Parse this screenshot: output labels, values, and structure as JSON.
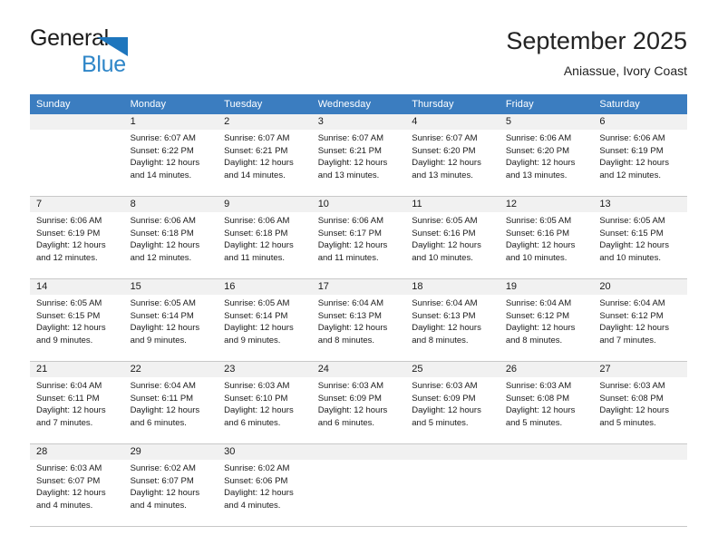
{
  "brand": {
    "line1": "General",
    "line2": "Blue",
    "mark": "triangle-logo-mark"
  },
  "header": {
    "title": "September 2025",
    "subtitle": "Aniassue, Ivory Coast"
  },
  "colors": {
    "header_blue": "#3b7dc0",
    "brand_blue": "#2f86c8",
    "mark_blue": "#1e76bd",
    "daynum_band": "#f1f1f1",
    "grid_line": "#c8c8c8",
    "text": "#1a1a1a"
  },
  "calendar": {
    "weekday_headers": [
      "Sunday",
      "Monday",
      "Tuesday",
      "Wednesday",
      "Thursday",
      "Friday",
      "Saturday"
    ],
    "weeks": [
      [
        {
          "day": "",
          "sunrise": "",
          "sunset": "",
          "daylight_1": "",
          "daylight_2": ""
        },
        {
          "day": "1",
          "sunrise": "Sunrise: 6:07 AM",
          "sunset": "Sunset: 6:22 PM",
          "daylight_1": "Daylight: 12 hours",
          "daylight_2": "and 14 minutes."
        },
        {
          "day": "2",
          "sunrise": "Sunrise: 6:07 AM",
          "sunset": "Sunset: 6:21 PM",
          "daylight_1": "Daylight: 12 hours",
          "daylight_2": "and 14 minutes."
        },
        {
          "day": "3",
          "sunrise": "Sunrise: 6:07 AM",
          "sunset": "Sunset: 6:21 PM",
          "daylight_1": "Daylight: 12 hours",
          "daylight_2": "and 13 minutes."
        },
        {
          "day": "4",
          "sunrise": "Sunrise: 6:07 AM",
          "sunset": "Sunset: 6:20 PM",
          "daylight_1": "Daylight: 12 hours",
          "daylight_2": "and 13 minutes."
        },
        {
          "day": "5",
          "sunrise": "Sunrise: 6:06 AM",
          "sunset": "Sunset: 6:20 PM",
          "daylight_1": "Daylight: 12 hours",
          "daylight_2": "and 13 minutes."
        },
        {
          "day": "6",
          "sunrise": "Sunrise: 6:06 AM",
          "sunset": "Sunset: 6:19 PM",
          "daylight_1": "Daylight: 12 hours",
          "daylight_2": "and 12 minutes."
        }
      ],
      [
        {
          "day": "7",
          "sunrise": "Sunrise: 6:06 AM",
          "sunset": "Sunset: 6:19 PM",
          "daylight_1": "Daylight: 12 hours",
          "daylight_2": "and 12 minutes."
        },
        {
          "day": "8",
          "sunrise": "Sunrise: 6:06 AM",
          "sunset": "Sunset: 6:18 PM",
          "daylight_1": "Daylight: 12 hours",
          "daylight_2": "and 12 minutes."
        },
        {
          "day": "9",
          "sunrise": "Sunrise: 6:06 AM",
          "sunset": "Sunset: 6:18 PM",
          "daylight_1": "Daylight: 12 hours",
          "daylight_2": "and 11 minutes."
        },
        {
          "day": "10",
          "sunrise": "Sunrise: 6:06 AM",
          "sunset": "Sunset: 6:17 PM",
          "daylight_1": "Daylight: 12 hours",
          "daylight_2": "and 11 minutes."
        },
        {
          "day": "11",
          "sunrise": "Sunrise: 6:05 AM",
          "sunset": "Sunset: 6:16 PM",
          "daylight_1": "Daylight: 12 hours",
          "daylight_2": "and 10 minutes."
        },
        {
          "day": "12",
          "sunrise": "Sunrise: 6:05 AM",
          "sunset": "Sunset: 6:16 PM",
          "daylight_1": "Daylight: 12 hours",
          "daylight_2": "and 10 minutes."
        },
        {
          "day": "13",
          "sunrise": "Sunrise: 6:05 AM",
          "sunset": "Sunset: 6:15 PM",
          "daylight_1": "Daylight: 12 hours",
          "daylight_2": "and 10 minutes."
        }
      ],
      [
        {
          "day": "14",
          "sunrise": "Sunrise: 6:05 AM",
          "sunset": "Sunset: 6:15 PM",
          "daylight_1": "Daylight: 12 hours",
          "daylight_2": "and 9 minutes."
        },
        {
          "day": "15",
          "sunrise": "Sunrise: 6:05 AM",
          "sunset": "Sunset: 6:14 PM",
          "daylight_1": "Daylight: 12 hours",
          "daylight_2": "and 9 minutes."
        },
        {
          "day": "16",
          "sunrise": "Sunrise: 6:05 AM",
          "sunset": "Sunset: 6:14 PM",
          "daylight_1": "Daylight: 12 hours",
          "daylight_2": "and 9 minutes."
        },
        {
          "day": "17",
          "sunrise": "Sunrise: 6:04 AM",
          "sunset": "Sunset: 6:13 PM",
          "daylight_1": "Daylight: 12 hours",
          "daylight_2": "and 8 minutes."
        },
        {
          "day": "18",
          "sunrise": "Sunrise: 6:04 AM",
          "sunset": "Sunset: 6:13 PM",
          "daylight_1": "Daylight: 12 hours",
          "daylight_2": "and 8 minutes."
        },
        {
          "day": "19",
          "sunrise": "Sunrise: 6:04 AM",
          "sunset": "Sunset: 6:12 PM",
          "daylight_1": "Daylight: 12 hours",
          "daylight_2": "and 8 minutes."
        },
        {
          "day": "20",
          "sunrise": "Sunrise: 6:04 AM",
          "sunset": "Sunset: 6:12 PM",
          "daylight_1": "Daylight: 12 hours",
          "daylight_2": "and 7 minutes."
        }
      ],
      [
        {
          "day": "21",
          "sunrise": "Sunrise: 6:04 AM",
          "sunset": "Sunset: 6:11 PM",
          "daylight_1": "Daylight: 12 hours",
          "daylight_2": "and 7 minutes."
        },
        {
          "day": "22",
          "sunrise": "Sunrise: 6:04 AM",
          "sunset": "Sunset: 6:11 PM",
          "daylight_1": "Daylight: 12 hours",
          "daylight_2": "and 6 minutes."
        },
        {
          "day": "23",
          "sunrise": "Sunrise: 6:03 AM",
          "sunset": "Sunset: 6:10 PM",
          "daylight_1": "Daylight: 12 hours",
          "daylight_2": "and 6 minutes."
        },
        {
          "day": "24",
          "sunrise": "Sunrise: 6:03 AM",
          "sunset": "Sunset: 6:09 PM",
          "daylight_1": "Daylight: 12 hours",
          "daylight_2": "and 6 minutes."
        },
        {
          "day": "25",
          "sunrise": "Sunrise: 6:03 AM",
          "sunset": "Sunset: 6:09 PM",
          "daylight_1": "Daylight: 12 hours",
          "daylight_2": "and 5 minutes."
        },
        {
          "day": "26",
          "sunrise": "Sunrise: 6:03 AM",
          "sunset": "Sunset: 6:08 PM",
          "daylight_1": "Daylight: 12 hours",
          "daylight_2": "and 5 minutes."
        },
        {
          "day": "27",
          "sunrise": "Sunrise: 6:03 AM",
          "sunset": "Sunset: 6:08 PM",
          "daylight_1": "Daylight: 12 hours",
          "daylight_2": "and 5 minutes."
        }
      ],
      [
        {
          "day": "28",
          "sunrise": "Sunrise: 6:03 AM",
          "sunset": "Sunset: 6:07 PM",
          "daylight_1": "Daylight: 12 hours",
          "daylight_2": "and 4 minutes."
        },
        {
          "day": "29",
          "sunrise": "Sunrise: 6:02 AM",
          "sunset": "Sunset: 6:07 PM",
          "daylight_1": "Daylight: 12 hours",
          "daylight_2": "and 4 minutes."
        },
        {
          "day": "30",
          "sunrise": "Sunrise: 6:02 AM",
          "sunset": "Sunset: 6:06 PM",
          "daylight_1": "Daylight: 12 hours",
          "daylight_2": "and 4 minutes."
        },
        {
          "day": "",
          "sunrise": "",
          "sunset": "",
          "daylight_1": "",
          "daylight_2": ""
        },
        {
          "day": "",
          "sunrise": "",
          "sunset": "",
          "daylight_1": "",
          "daylight_2": ""
        },
        {
          "day": "",
          "sunrise": "",
          "sunset": "",
          "daylight_1": "",
          "daylight_2": ""
        },
        {
          "day": "",
          "sunrise": "",
          "sunset": "",
          "daylight_1": "",
          "daylight_2": ""
        }
      ]
    ]
  }
}
